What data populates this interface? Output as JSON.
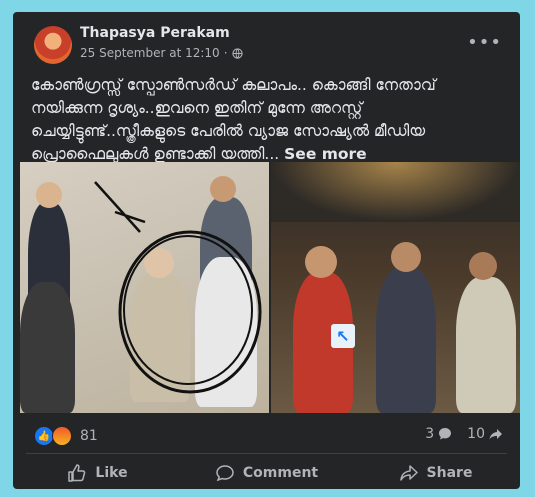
{
  "post": {
    "author": "Thapasya Perakam",
    "timestamp": "25 September at 12:10",
    "separator": "·",
    "more_label": "•••",
    "text": "കോൺഗ്രസ്സ് സ്പോൺസർഡ് കലാപം.. കൊങ്ങി നേതാവ് നയിക്കുന്ന ദൃശ്യം..ഇവനെ ഇതിന് മുന്നേ അറസ്റ്റ് ചെയ്യിട്ടുണ്ട്..സ്ത്രീകളുടെ പേരിൽ വ്യാജ സോഷ്യൽ മീഡിയ പ്രൊഫൈലുകൾ ഉണ്ടാക്കി യത്തി...",
    "see_more": "See more"
  },
  "engagement": {
    "reaction_count": "81",
    "comment_count": "3",
    "share_count": "10"
  },
  "actions": {
    "like": "Like",
    "comment": "Comment",
    "share": "Share"
  },
  "colors": {
    "background": "#7fd6e6",
    "card": "#242526",
    "text": "#e4e6eb",
    "muted": "#b0b3b8",
    "like_blue": "#1877f2"
  },
  "icons": [
    "globe-icon",
    "more-options-icon",
    "like-reaction-icon",
    "angry-reaction-icon",
    "comment-icon",
    "share-icon",
    "like-icon"
  ]
}
